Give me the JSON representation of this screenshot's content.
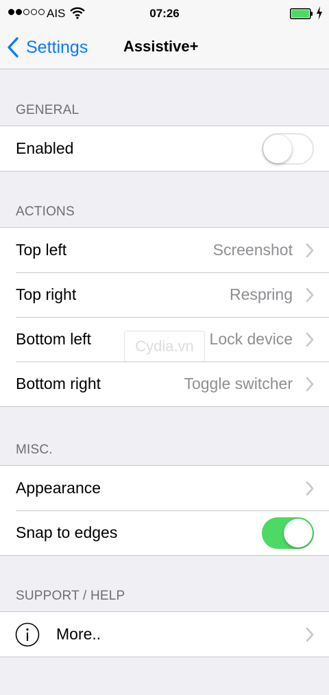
{
  "status_bar": {
    "carrier": "AIS",
    "time": "07:26",
    "signal_bars_filled": 2,
    "signal_bars_total": 5
  },
  "nav": {
    "back_label": "Settings",
    "title": "Assistive+"
  },
  "sections": {
    "general": {
      "header": "GENERAL",
      "enabled_label": "Enabled",
      "enabled_on": false
    },
    "actions": {
      "header": "ACTIONS",
      "rows": [
        {
          "label": "Top left",
          "value": "Screenshot"
        },
        {
          "label": "Top right",
          "value": "Respring"
        },
        {
          "label": "Bottom left",
          "value": "Lock device"
        },
        {
          "label": "Bottom right",
          "value": "Toggle switcher"
        }
      ]
    },
    "misc": {
      "header": "MISC.",
      "appearance_label": "Appearance",
      "snap_label": "Snap to edges",
      "snap_on": true
    },
    "support": {
      "header": "SUPPORT / HELP",
      "more_label": "More.."
    }
  },
  "watermark": "Cydia.vn",
  "colors": {
    "accent": "#0a7aff",
    "toggle_on": "#4cd964",
    "battery": "#4cd964",
    "background": "#efeff4"
  }
}
